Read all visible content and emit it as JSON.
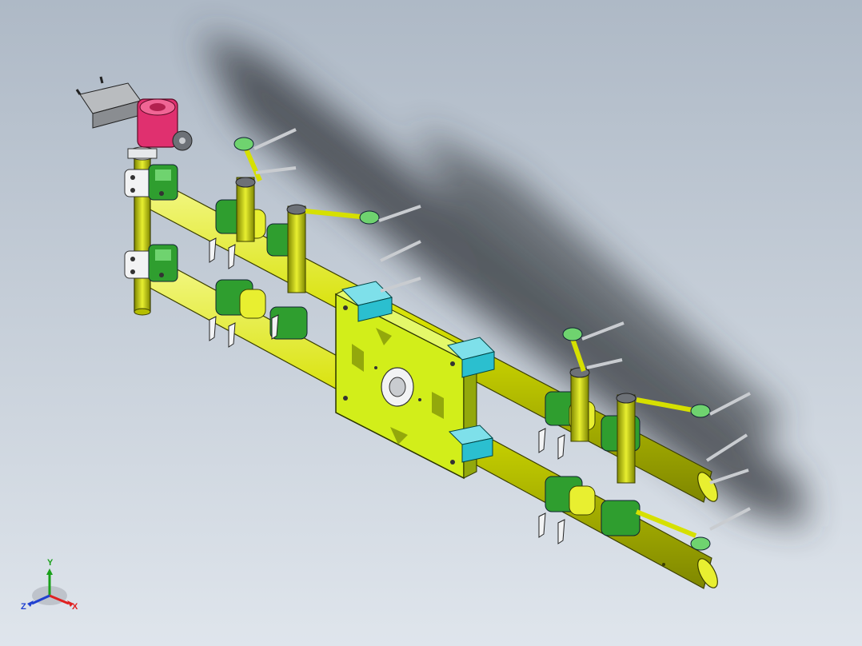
{
  "viewport": {
    "background_top": "#aeb9c6",
    "background_bottom": "#dfe5ec"
  },
  "colors": {
    "tube": "#d6e000",
    "tube_dark": "#8c9400",
    "clamp": "#2f9e2f",
    "clamp_light": "#6fd36f",
    "plate": "#d2ee1a",
    "plate_dark": "#93a80c",
    "block_cyan": "#2bbfcf",
    "gripper_magenta": "#e0306f",
    "steel": "#c9ccd0",
    "steel_dark": "#6d7177",
    "shadow": "#30343a"
  },
  "model": {
    "icons": [
      "tooling-fixture-model",
      "gripper-head-icon"
    ]
  },
  "triad": {
    "x_label": "X",
    "y_label": "Y",
    "z_label": "Z",
    "x_color": "#e02020",
    "y_color": "#1aa01a",
    "z_color": "#2040d0"
  }
}
